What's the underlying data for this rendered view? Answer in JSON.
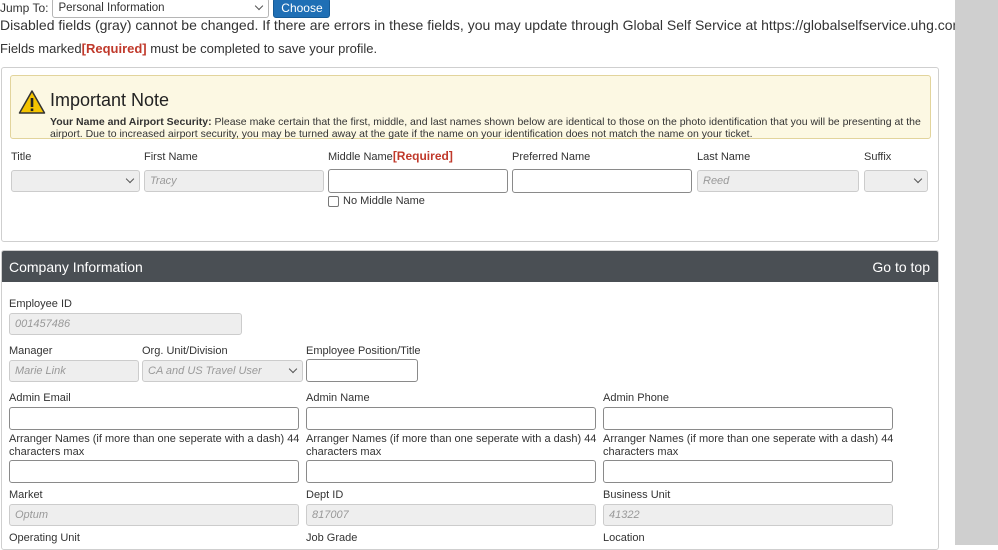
{
  "jump": {
    "label": "Jump To:",
    "selected": "Personal Information",
    "button": "Choose"
  },
  "notes": {
    "disabled_text": "Disabled fields (gray) cannot be changed. If there are errors in these fields, you may update through Global Self Service at https://globalselfservice.uhg.com",
    "fields_marked": "Fields marked",
    "required_tag": "[Required]",
    "must_complete": " must be completed to save your profile."
  },
  "important": {
    "title": "Important Note",
    "bold": "Your Name and Airport Security:",
    "body": " Please make certain that the first, middle, and last names shown below are identical to those on the photo identification that you will be presenting at the airport. Due to increased airport security, you may be turned away at the gate if the name on your identification does not match the name on your ticket."
  },
  "name": {
    "title_label": "Title",
    "title_value": "",
    "first_label": "First Name",
    "first_value": "Tracy",
    "middle_label": "Middle Name",
    "middle_required": "[Required]",
    "middle_value": "",
    "preferred_label": "Preferred Name",
    "preferred_value": "",
    "last_label": "Last Name",
    "last_value": "Reed",
    "suffix_label": "Suffix",
    "suffix_value": "",
    "no_middle": "No Middle Name"
  },
  "company": {
    "header": "Company Information",
    "goto_top": "Go to top",
    "employee_id_label": "Employee ID",
    "employee_id": "001457486",
    "manager_label": "Manager",
    "manager": "Marie Link",
    "org_label": "Org. Unit/Division",
    "org": "CA and US Travel User",
    "position_label": "Employee Position/Title",
    "position": "",
    "admin_email_label": "Admin Email",
    "admin_name_label": "Admin Name",
    "admin_phone_label": "Admin Phone",
    "arranger_label": "Arranger Names (if more than one seperate with a dash) 44 characters max",
    "market_label": "Market",
    "market": "Optum",
    "dept_label": "Dept ID",
    "dept": "817007",
    "bu_label": "Business Unit",
    "bu": "41322",
    "operating_label": "Operating Unit",
    "job_label": "Job Grade",
    "location_label": "Location"
  },
  "colors": {
    "primary_button": "#1f6fb5",
    "required": "#c0392b",
    "header_bg": "#4a4f54",
    "warning_bg": "#fcf8e3"
  }
}
